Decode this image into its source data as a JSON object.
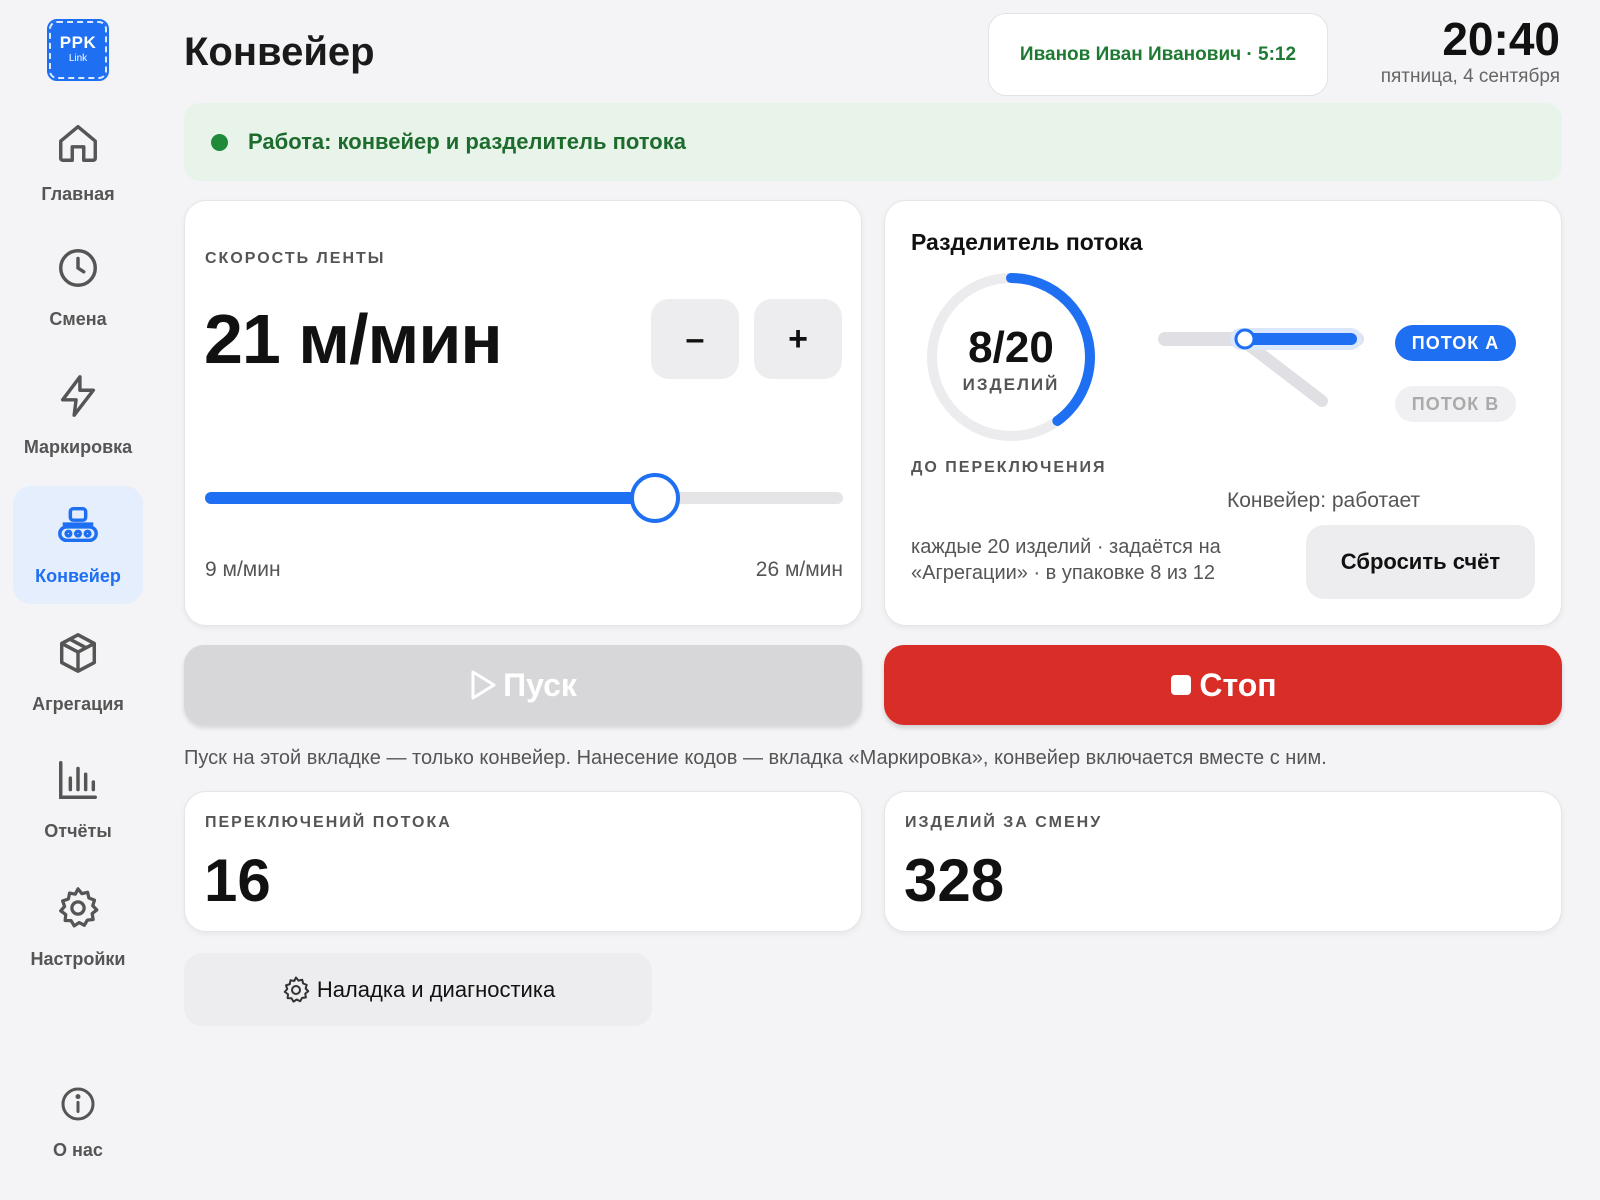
{
  "app": {
    "logo_line1": "PPK",
    "logo_line2": "Link"
  },
  "sidebar": {
    "items": [
      {
        "label": "Главная",
        "icon": "home-icon",
        "active": false
      },
      {
        "label": "Смена",
        "icon": "clock-icon",
        "active": false
      },
      {
        "label": "Маркировка",
        "icon": "lightning-icon",
        "active": false
      },
      {
        "label": "Конвейер",
        "icon": "conveyor-icon",
        "active": true
      },
      {
        "label": "Агрегация",
        "icon": "box-icon",
        "active": false
      },
      {
        "label": "Отчёты",
        "icon": "bar-chart-icon",
        "active": false
      },
      {
        "label": "Настройки",
        "icon": "gear-icon",
        "active": false
      }
    ],
    "about": {
      "label": "О нас",
      "icon": "info-icon"
    }
  },
  "header": {
    "title": "Конвейер",
    "user": "Иванов Иван Иванович · 5:12",
    "time": "20:40",
    "date": "пятница, 4 сентября"
  },
  "status": {
    "text": "Работа: конвейер и разделитель потока",
    "color": "#1e8a3a"
  },
  "speed": {
    "label": "СКОРОСТЬ ЛЕНТЫ",
    "value": "21 м/мин",
    "minus_label": "–",
    "plus_label": "+",
    "min_label": "9 м/мин",
    "max_label": "26 м/мин",
    "min": 9,
    "max": 26,
    "current": 21
  },
  "splitter": {
    "title": "Разделитель потока",
    "count": "8/20",
    "count_unit": "ИЗДЕЛИЙ",
    "done": 8,
    "total": 20,
    "until_label": "ДО ПЕРЕКЛЮЧЕНИЯ",
    "flow_a": "ПОТОК А",
    "flow_b": "ПОТОК В",
    "active_flow": "A",
    "conveyor_state": "Конвейер: работает",
    "note": "каждые 20 изделий · задаётся на «Агрегации» · в упаковке 8 из 12",
    "reset_label": "Сбросить счёт"
  },
  "controls": {
    "start_label": "Пуск",
    "stop_label": "Стоп",
    "hint": "Пуск на этой вкладке — только конвейер. Нанесение кодов — вкладка «Маркировка», конвейер включается вместе с ним."
  },
  "stats": {
    "switches_label": "ПЕРЕКЛЮЧЕНИЙ ПОТОКА",
    "switches_value": "16",
    "items_label": "ИЗДЕЛИЙ ЗА СМЕНУ",
    "items_value": "328"
  },
  "diagnostics": {
    "label": "Наладка и диагностика"
  },
  "colors": {
    "accent": "#1f6ff2",
    "stop": "#d92d27",
    "ok": "#1e8a3a"
  }
}
